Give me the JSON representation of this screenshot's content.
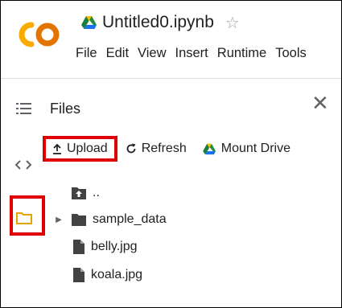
{
  "header": {
    "title": "Untitled0.ipynb",
    "menu": [
      "File",
      "Edit",
      "View",
      "Insert",
      "Runtime",
      "Tools"
    ]
  },
  "files_panel": {
    "title": "Files",
    "toolbar": {
      "upload_label": "Upload",
      "refresh_label": "Refresh",
      "mount_drive_label": "Mount Drive"
    },
    "tree": [
      {
        "name": "..",
        "type": "parent",
        "icon": "folder-up-icon"
      },
      {
        "name": "sample_data",
        "type": "folder",
        "icon": "folder-icon"
      },
      {
        "name": "belly.jpg",
        "type": "file",
        "icon": "file-icon"
      },
      {
        "name": "koala.jpg",
        "type": "file",
        "icon": "file-icon"
      }
    ]
  },
  "colors": {
    "logo_orange": "#f9ab00",
    "highlight_red": "#e00000",
    "folder_orange": "#e8a200"
  }
}
